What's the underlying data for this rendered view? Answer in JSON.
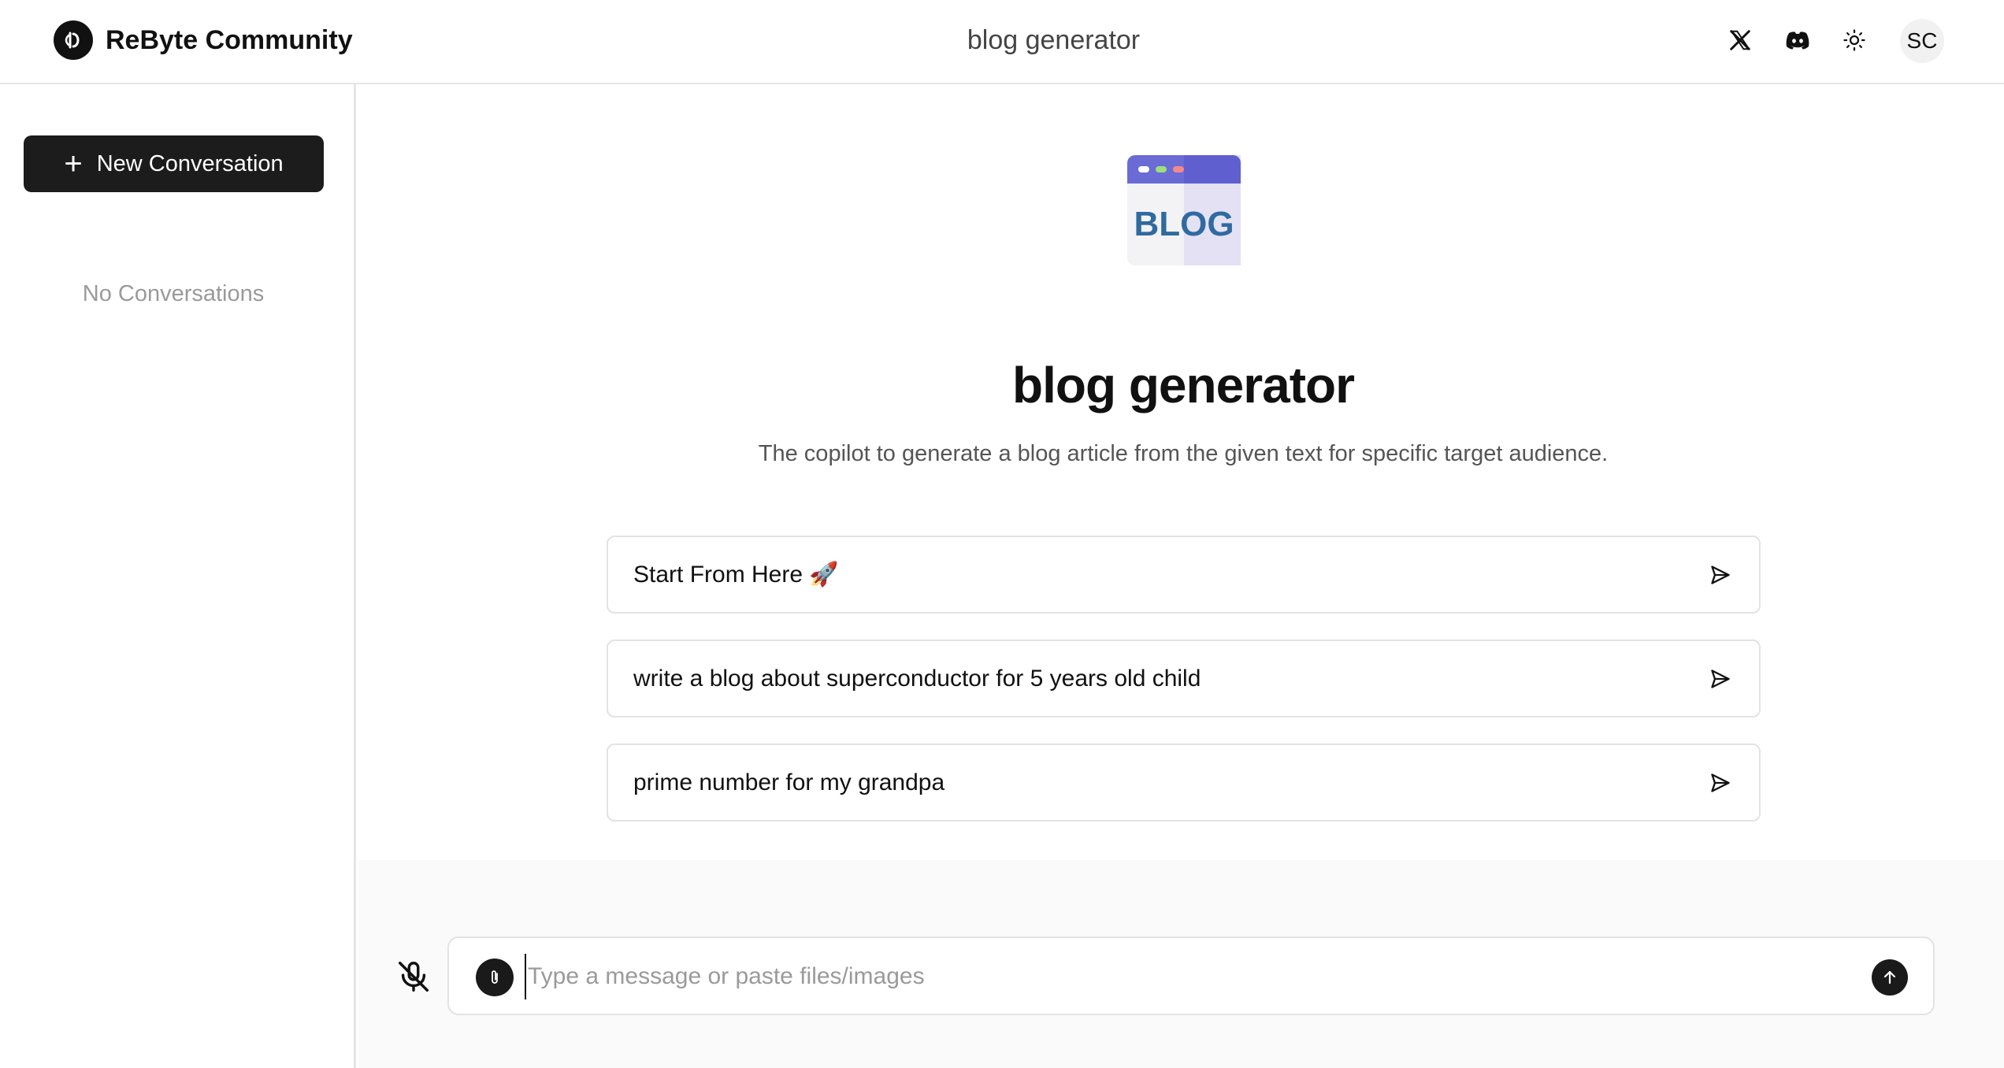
{
  "header": {
    "brand_name": "ReByte Community",
    "title": "blog generator",
    "avatar_initials": "SC",
    "icons": [
      "x-logo-icon",
      "discord-icon",
      "sun-icon"
    ]
  },
  "sidebar": {
    "new_conversation_label": "New Conversation",
    "empty_text": "No Conversations"
  },
  "main": {
    "app_icon": "blog-logo",
    "app_icon_text": "BLOG",
    "app_title": "blog generator",
    "app_description": "The copilot to generate a blog article from the given text for specific target audience.",
    "suggestions": [
      {
        "label": "Start From Here 🚀"
      },
      {
        "label": "write a blog about superconductor for 5 years old child"
      },
      {
        "label": "prime number for my grandpa"
      }
    ]
  },
  "composer": {
    "placeholder": "Type a message or paste files/images",
    "value": ""
  },
  "colors": {
    "primary_dark": "#1c1c1c",
    "border": "#e3e3e3",
    "muted_text": "#9a9a9a",
    "blog_icon_header": "#6b6bd6",
    "blog_text": "#2f6aa0"
  }
}
